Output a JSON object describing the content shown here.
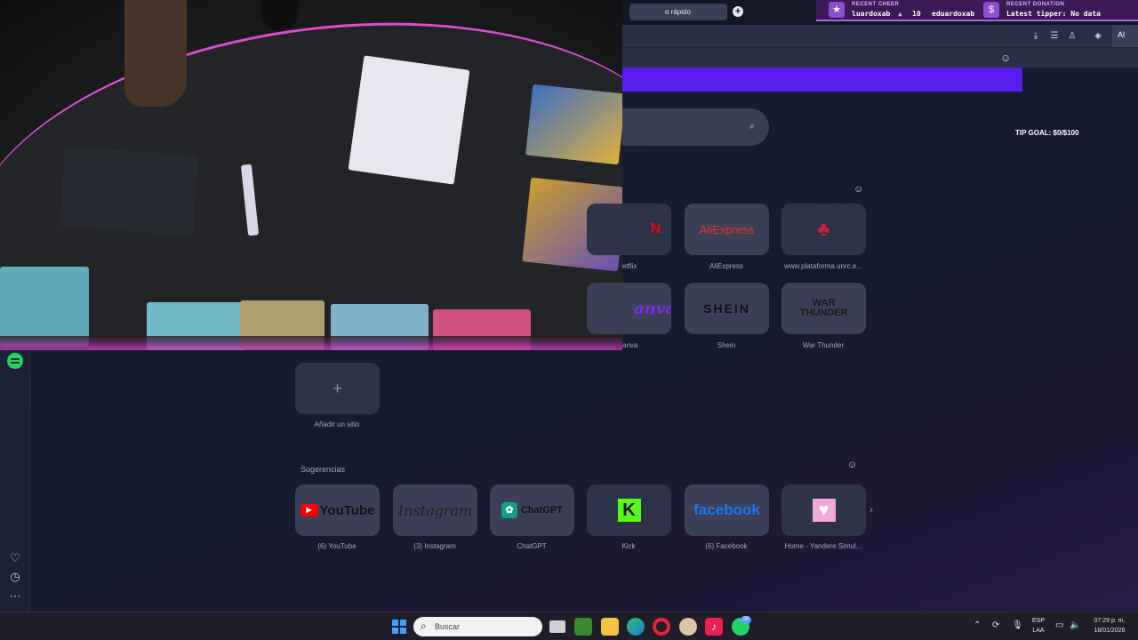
{
  "browser": {
    "tab_label": "o rápido",
    "new_tab_symbol": "+",
    "ai_button": "Al",
    "toolbar_icons": [
      "download-icon",
      "menu-icon",
      "account-icon",
      "cube-icon"
    ]
  },
  "overlay": {
    "recent_cheer_label": "RECENT CHEER",
    "recent_cheer_user": "luardoxab",
    "recent_cheer_amount": "10",
    "recent_cheer_user2": "eduardoxab",
    "recent_donation_label": "RECENT DONATION",
    "recent_donation_text": "Latest tipper: No data"
  },
  "tip_goal": "TIP GOAL: $0/$100",
  "speed_dial": {
    "row1": [
      {
        "caption": "etflix",
        "logo": "N"
      },
      {
        "caption": "AliExpress",
        "logo": "AliExpress"
      },
      {
        "caption": "www.plataforma.unrc.e...",
        "logo": "♣"
      }
    ],
    "row2": [
      {
        "caption": "anva",
        "logo": "anva"
      },
      {
        "caption": "Shein",
        "logo": "SHEIN"
      },
      {
        "caption": "War Thunder",
        "logo": "WAR THUNDER"
      }
    ],
    "add_site": {
      "caption": "Añadir un sitio",
      "symbol": "+"
    }
  },
  "suggestions": {
    "title": "Sugerencias",
    "items": [
      {
        "caption": "(6) YouTube",
        "logo": "YouTube"
      },
      {
        "caption": "(3) Instagram",
        "logo": "Instagram"
      },
      {
        "caption": "ChatGPT",
        "logo": "ChatGPT"
      },
      {
        "caption": "Kick",
        "logo": "K"
      },
      {
        "caption": "(6) Facebook",
        "logo": "facebook"
      },
      {
        "caption": "Home - Yandere Simul...",
        "logo": "♥"
      }
    ]
  },
  "taskbar": {
    "search_placeholder": "Buscar",
    "language": "ESP",
    "language_sub": "LAA",
    "time": "07:29 p. m.",
    "date": "18/01/2026",
    "whatsapp_badge": "38"
  },
  "colors": {
    "accent_purple": "#5b1cf0",
    "overlay_purple": "#3c1a55",
    "spotify_green": "#1ed760"
  }
}
